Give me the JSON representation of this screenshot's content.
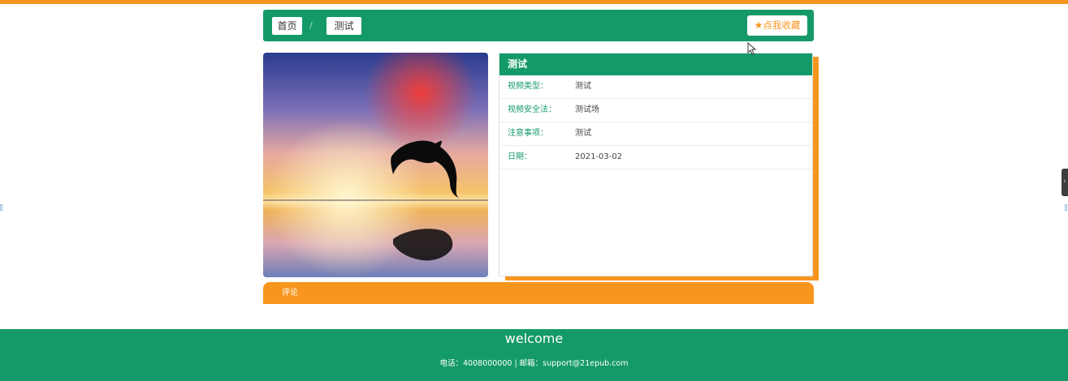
{
  "breadcrumb": {
    "home_label": "首页",
    "separator": "/",
    "current_label": "测试"
  },
  "favorite_button": {
    "icon": "star-icon",
    "label": "点我收藏"
  },
  "detail": {
    "title": "测试",
    "rows": [
      {
        "label": "视频类型：",
        "value": "测试"
      },
      {
        "label": "视频安全法：",
        "value": "测试场"
      },
      {
        "label": "注意事项：",
        "value": "测试"
      },
      {
        "label": "日期：",
        "value": "2021-03-02"
      }
    ]
  },
  "comment": {
    "label": "评论"
  },
  "footer": {
    "welcome": "welcome",
    "contact": "电话：4008000000 | 邮箱：support@21epub.com"
  },
  "colors": {
    "primary": "#149a68",
    "accent": "#f6961f"
  }
}
